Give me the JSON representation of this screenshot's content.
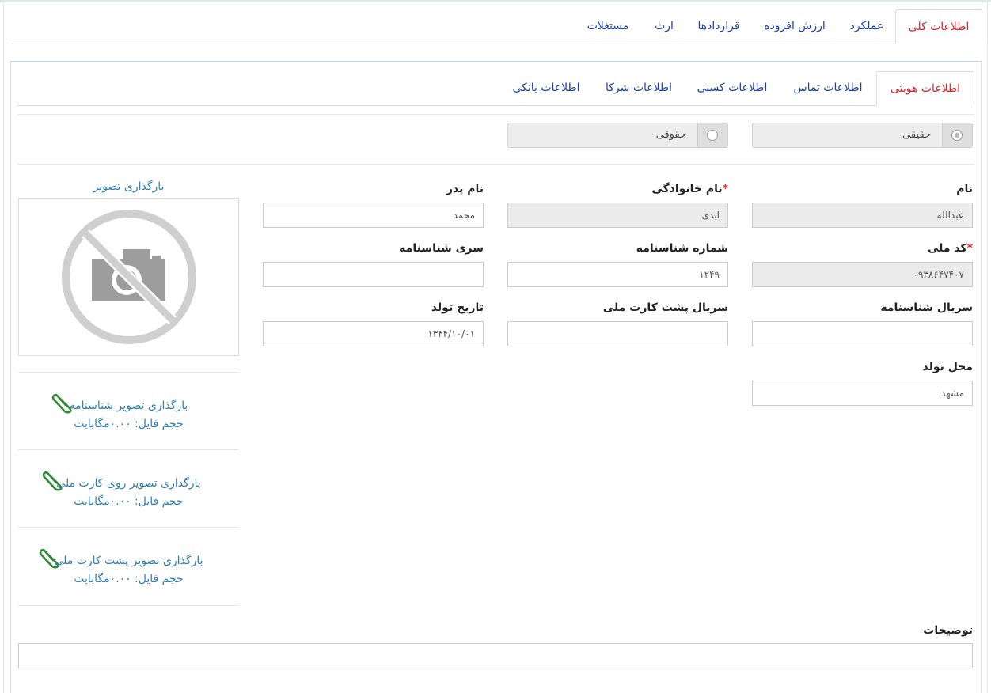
{
  "main_tabs": [
    "اطلاعات کلی",
    "عملکرد",
    "ارزش افزوده",
    "قراردادها",
    "ارث",
    "مستغلات"
  ],
  "sub_tabs": [
    "اطلاعات هویتی",
    "اطلاعات تماس",
    "اطلاعات کسبی",
    "اطلاعات شرکا",
    "اطلاعات بانکی"
  ],
  "person_type": {
    "real": "حقیقی",
    "legal": "حقوقی"
  },
  "form": {
    "first_name_label": "نام",
    "first_name_value": "عبدالله",
    "last_name_label": "نام خانوادگی",
    "last_name_value": "ابدی",
    "father_name_label": "نام پدر",
    "father_name_value": "محمد",
    "national_code_label": "کد ملی",
    "national_code_value": "۰۹۳۸۶۴۷۴۰۷",
    "id_number_label": "شماره شناسنامه",
    "id_number_value": "۱۲۴۹",
    "id_series_label": "سری شناسنامه",
    "id_series_value": "",
    "id_serial_label": "سریال شناسنامه",
    "id_serial_value": "",
    "card_back_serial_label": "سریال پشت کارت ملی",
    "card_back_serial_value": "",
    "birth_date_label": "تاریخ تولد",
    "birth_date_value": "۱۳۴۴/۱۰/۰۱",
    "birth_place_label": "محل تولد",
    "birth_place_value": "مشهد",
    "notes_label": "توضیحات",
    "notes_value": "",
    "required_mark": "*"
  },
  "uploads": {
    "photo_title": "بارگذاری تصویر",
    "items": [
      {
        "title": "بارگذاری تصویر شناسنامه",
        "size": "حجم فایل: ۰.۰۰مگابایت"
      },
      {
        "title": "بارگذاری تصویر روی کارت ملی",
        "size": "حجم فایل: ۰.۰۰مگابایت"
      },
      {
        "title": "بارگذاری تصویر پشت کارت ملی",
        "size": "حجم فایل: ۰.۰۰مگابایت"
      }
    ]
  },
  "icons": {
    "no_image": "no-camera-icon",
    "attachment": "paperclip-icon"
  },
  "colors": {
    "active_tab": "#d9232d",
    "tab_link": "#1a3fa8",
    "upload_link": "#2e7fb3",
    "paperclip": "#2e8a2e"
  }
}
